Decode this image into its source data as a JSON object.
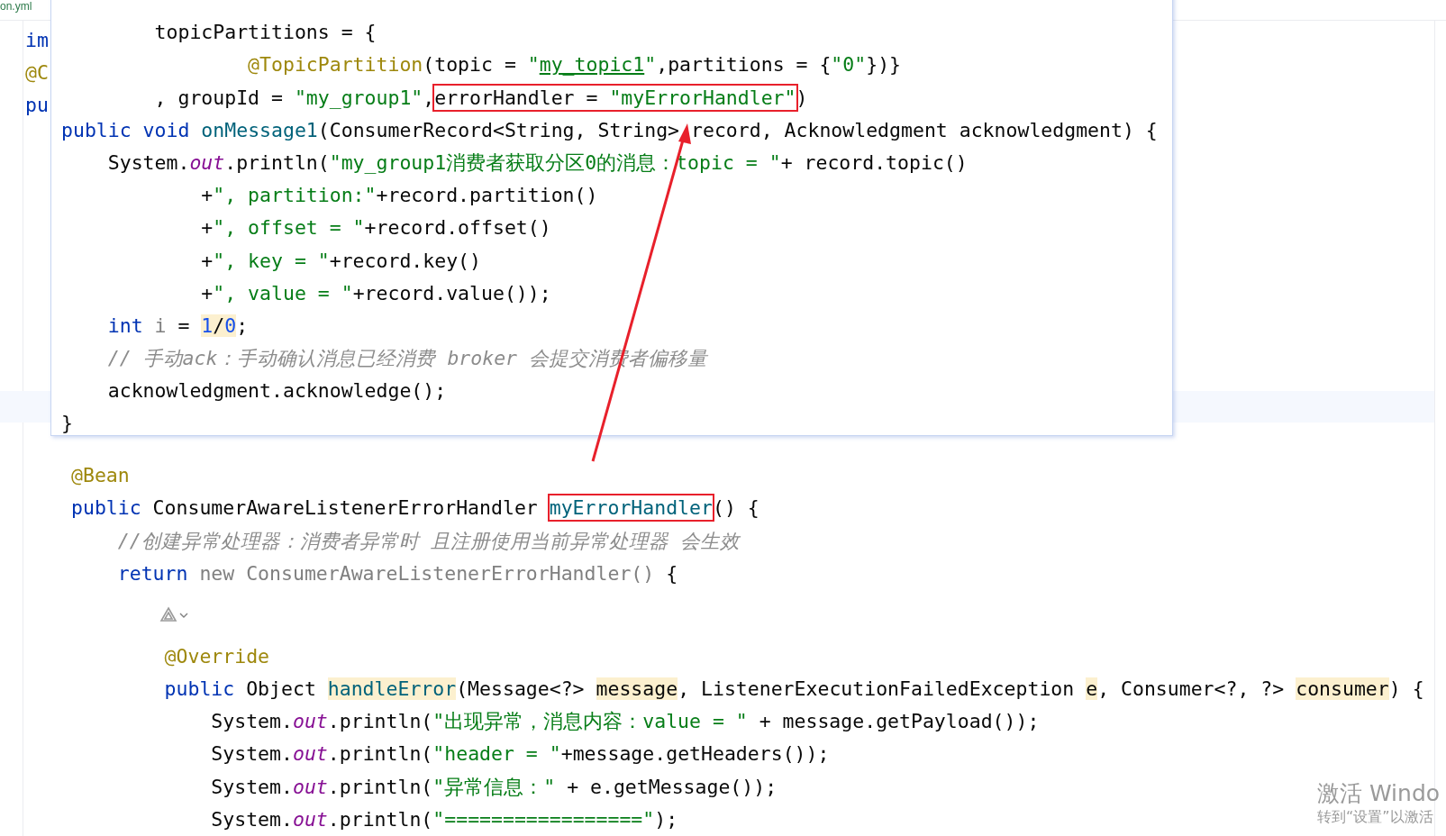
{
  "file_tab": {
    "label": "on.yml"
  },
  "background_fragments": [
    {
      "t": "im",
      "kind": "kw"
    },
    {
      "t": "@C",
      "kind": "ann"
    },
    {
      "t": "pu",
      "kind": "kw"
    }
  ],
  "popup": {
    "lines": [
      {
        "tokens": [
          {
            "t": "        topicPartitions = {",
            "kind": "plain"
          }
        ]
      },
      {
        "tokens": [
          {
            "t": "                @TopicPartition",
            "kind": "ann"
          },
          {
            "t": "(topic = ",
            "kind": "plain"
          },
          {
            "t": "\"",
            "kind": "str"
          },
          {
            "t": "my_topic1",
            "kind": "str",
            "underline": true
          },
          {
            "t": "\"",
            "kind": "str"
          },
          {
            "t": ",partitions = {",
            "kind": "plain"
          },
          {
            "t": "\"0\"",
            "kind": "str"
          },
          {
            "t": "})}",
            "kind": "plain"
          }
        ]
      },
      {
        "tokens": [
          {
            "t": "        , groupId = ",
            "kind": "plain"
          },
          {
            "t": "\"my_group1\"",
            "kind": "str"
          },
          {
            "t": ",",
            "kind": "plain"
          },
          {
            "boxed": true,
            "parts": [
              {
                "t": "errorHandler = ",
                "kind": "plain"
              },
              {
                "t": "\"myErrorHandler\"",
                "kind": "str"
              }
            ]
          },
          {
            "t": ")",
            "kind": "plain"
          }
        ]
      },
      {
        "tokens": [
          {
            "t": "public",
            "kind": "kw"
          },
          {
            "t": " void",
            "kind": "kw"
          },
          {
            "t": " onMessage1",
            "kind": "decl"
          },
          {
            "t": "(ConsumerRecord<String, String> record, Acknowledgment acknowledgment) {",
            "kind": "plain"
          }
        ]
      },
      {
        "tokens": [
          {
            "t": "    System.",
            "kind": "plain"
          },
          {
            "t": "out",
            "kind": "field"
          },
          {
            "t": ".println(",
            "kind": "plain"
          },
          {
            "t": "\"my_group1消费者获取分区0的消息：topic = \"",
            "kind": "str"
          },
          {
            "t": "+ record.topic()",
            "kind": "plain"
          }
        ]
      },
      {
        "tokens": [
          {
            "t": "            +",
            "kind": "plain"
          },
          {
            "t": "\", partition:\"",
            "kind": "str"
          },
          {
            "t": "+record.partition()",
            "kind": "plain"
          }
        ]
      },
      {
        "tokens": [
          {
            "t": "            +",
            "kind": "plain"
          },
          {
            "t": "\", offset = \"",
            "kind": "str"
          },
          {
            "t": "+record.offset()",
            "kind": "plain"
          }
        ]
      },
      {
        "tokens": [
          {
            "t": "            +",
            "kind": "plain"
          },
          {
            "t": "\", key = \"",
            "kind": "str"
          },
          {
            "t": "+record.key()",
            "kind": "plain"
          }
        ]
      },
      {
        "tokens": [
          {
            "t": "            +",
            "kind": "plain"
          },
          {
            "t": "\", value = \"",
            "kind": "str"
          },
          {
            "t": "+record.value());",
            "kind": "plain"
          }
        ]
      },
      {
        "tokens": [
          {
            "t": "    int",
            "kind": "kw"
          },
          {
            "t": " i",
            "kind": "unused"
          },
          {
            "t": " = ",
            "kind": "plain"
          },
          {
            "t": "1",
            "kind": "num",
            "hl": true
          },
          {
            "t": "/",
            "kind": "plain",
            "hl": true
          },
          {
            "t": "0",
            "kind": "num",
            "hl": true
          },
          {
            "t": ";",
            "kind": "plain"
          }
        ]
      },
      {
        "tokens": [
          {
            "t": "    // 手动ack：手动确认消息已经消费 broker 会提交消费者偏移量",
            "kind": "comment"
          }
        ]
      },
      {
        "tokens": [
          {
            "t": "    acknowledgment.acknowledge();",
            "kind": "plain"
          }
        ]
      },
      {
        "tokens": [
          {
            "t": "}",
            "kind": "plain"
          }
        ]
      }
    ]
  },
  "editor": {
    "lines": [
      {
        "kind": "code",
        "tokens": [
          {
            "t": "@Bean",
            "kind": "ann"
          }
        ]
      },
      {
        "kind": "code",
        "tokens": [
          {
            "t": "public",
            "kind": "kw"
          },
          {
            "t": " ConsumerAwareListenerErrorHandler ",
            "kind": "plain"
          },
          {
            "boxed": true,
            "parts": [
              {
                "t": "myErrorHandler",
                "kind": "decl"
              }
            ]
          },
          {
            "t": "() {",
            "kind": "plain"
          }
        ]
      },
      {
        "kind": "code",
        "tokens": [
          {
            "t": "    //创建异常处理器：消费者异常时 且注册使用当前异常处理器 会生效",
            "kind": "comment"
          }
        ]
      },
      {
        "kind": "code",
        "tokens": [
          {
            "t": "    return",
            "kind": "kw"
          },
          {
            "t": " new ConsumerAwareListenerErrorHandler()",
            "kind": "unused"
          },
          {
            "t": " {",
            "kind": "plain"
          }
        ]
      },
      {
        "kind": "gutter_icon"
      },
      {
        "kind": "code",
        "tokens": [
          {
            "t": "        @Override",
            "kind": "ann"
          }
        ]
      },
      {
        "kind": "code",
        "tokens": [
          {
            "t": "        public",
            "kind": "kw"
          },
          {
            "t": " Object ",
            "kind": "plain"
          },
          {
            "t": "handleError",
            "kind": "decl",
            "hl": true
          },
          {
            "t": "(Message<?> ",
            "kind": "plain"
          },
          {
            "t": "message",
            "kind": "plain",
            "hl": true
          },
          {
            "t": ", ListenerExecutionFailedException ",
            "kind": "plain"
          },
          {
            "t": "e",
            "kind": "plain",
            "hl": true
          },
          {
            "t": ", Consumer<?, ?> ",
            "kind": "plain"
          },
          {
            "t": "consumer",
            "kind": "plain",
            "hl": true
          },
          {
            "t": ") {",
            "kind": "plain"
          }
        ]
      },
      {
        "kind": "code",
        "tokens": [
          {
            "t": "            System.",
            "kind": "plain"
          },
          {
            "t": "out",
            "kind": "field"
          },
          {
            "t": ".println(",
            "kind": "plain"
          },
          {
            "t": "\"出现异常，消息内容：value = \"",
            "kind": "str"
          },
          {
            "t": " + message.getPayload());",
            "kind": "plain"
          }
        ]
      },
      {
        "kind": "code",
        "tokens": [
          {
            "t": "            System.",
            "kind": "plain"
          },
          {
            "t": "out",
            "kind": "field"
          },
          {
            "t": ".println(",
            "kind": "plain"
          },
          {
            "t": "\"header = \"",
            "kind": "str"
          },
          {
            "t": "+message.getHeaders());",
            "kind": "plain"
          }
        ]
      },
      {
        "kind": "code",
        "tokens": [
          {
            "t": "            System.",
            "kind": "plain"
          },
          {
            "t": "out",
            "kind": "field"
          },
          {
            "t": ".println(",
            "kind": "plain"
          },
          {
            "t": "\"异常信息：\" ",
            "kind": "str"
          },
          {
            "t": "+ e.getMessage());",
            "kind": "plain"
          }
        ]
      },
      {
        "kind": "code",
        "tokens": [
          {
            "t": "            System.",
            "kind": "plain"
          },
          {
            "t": "out",
            "kind": "field"
          },
          {
            "t": ".println(",
            "kind": "plain"
          },
          {
            "t": "\"=================\"",
            "kind": "str"
          },
          {
            "t": ");",
            "kind": "plain"
          }
        ]
      }
    ]
  },
  "os_notice": {
    "title": "激活 Windo",
    "subtitle": "转到“设置”以激活"
  }
}
